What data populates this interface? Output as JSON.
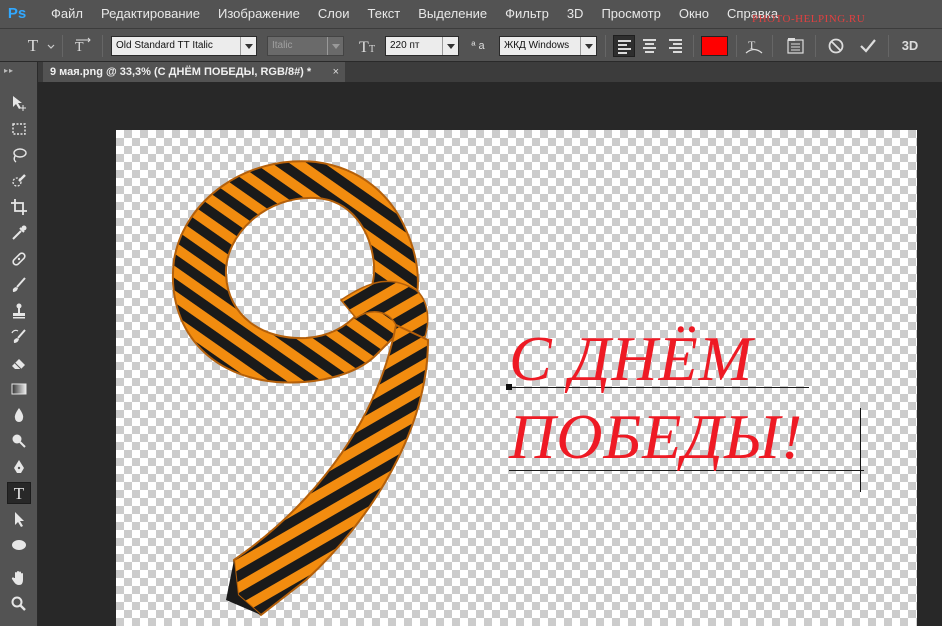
{
  "app": {
    "logo": "Ps",
    "watermark": "PHOTO-HELPING.RU"
  },
  "menu": [
    "Файл",
    "Редактирование",
    "Изображение",
    "Слои",
    "Текст",
    "Выделение",
    "Фильтр",
    "3D",
    "Просмотр",
    "Окно",
    "Справка"
  ],
  "options": {
    "tool_icon": "type-icon",
    "font_family": "Old Standard TT Italic",
    "font_style": "Italic",
    "font_size": "220 пт",
    "antialias_label": "ª a",
    "antialias": "ЖКД Windows",
    "text_color": "#ff0000",
    "three_d_label": "3D"
  },
  "tab": {
    "title": "9 мая.png @ 33,3% (С ДНЁМ   ПОБЕДЫ, RGB/8#) *",
    "close": "×"
  },
  "tools": [
    "move-icon",
    "marquee-icon",
    "lasso-icon",
    "quick-select-icon",
    "crop-icon",
    "eyedropper-icon",
    "healing-icon",
    "brush-icon",
    "stamp-icon",
    "history-brush-icon",
    "eraser-icon",
    "gradient-icon",
    "blur-icon",
    "dodge-icon",
    "pen-icon",
    "type-icon",
    "path-select-icon",
    "ellipse-icon",
    "hand-icon",
    "zoom-icon"
  ],
  "canvas": {
    "text_line1": "С ДНЁМ",
    "text_line2": "ПОБЕДЫ!",
    "text_color": "#ee1a24",
    "ribbon_colors": [
      "#1a1a1a",
      "#f28c0f"
    ]
  }
}
